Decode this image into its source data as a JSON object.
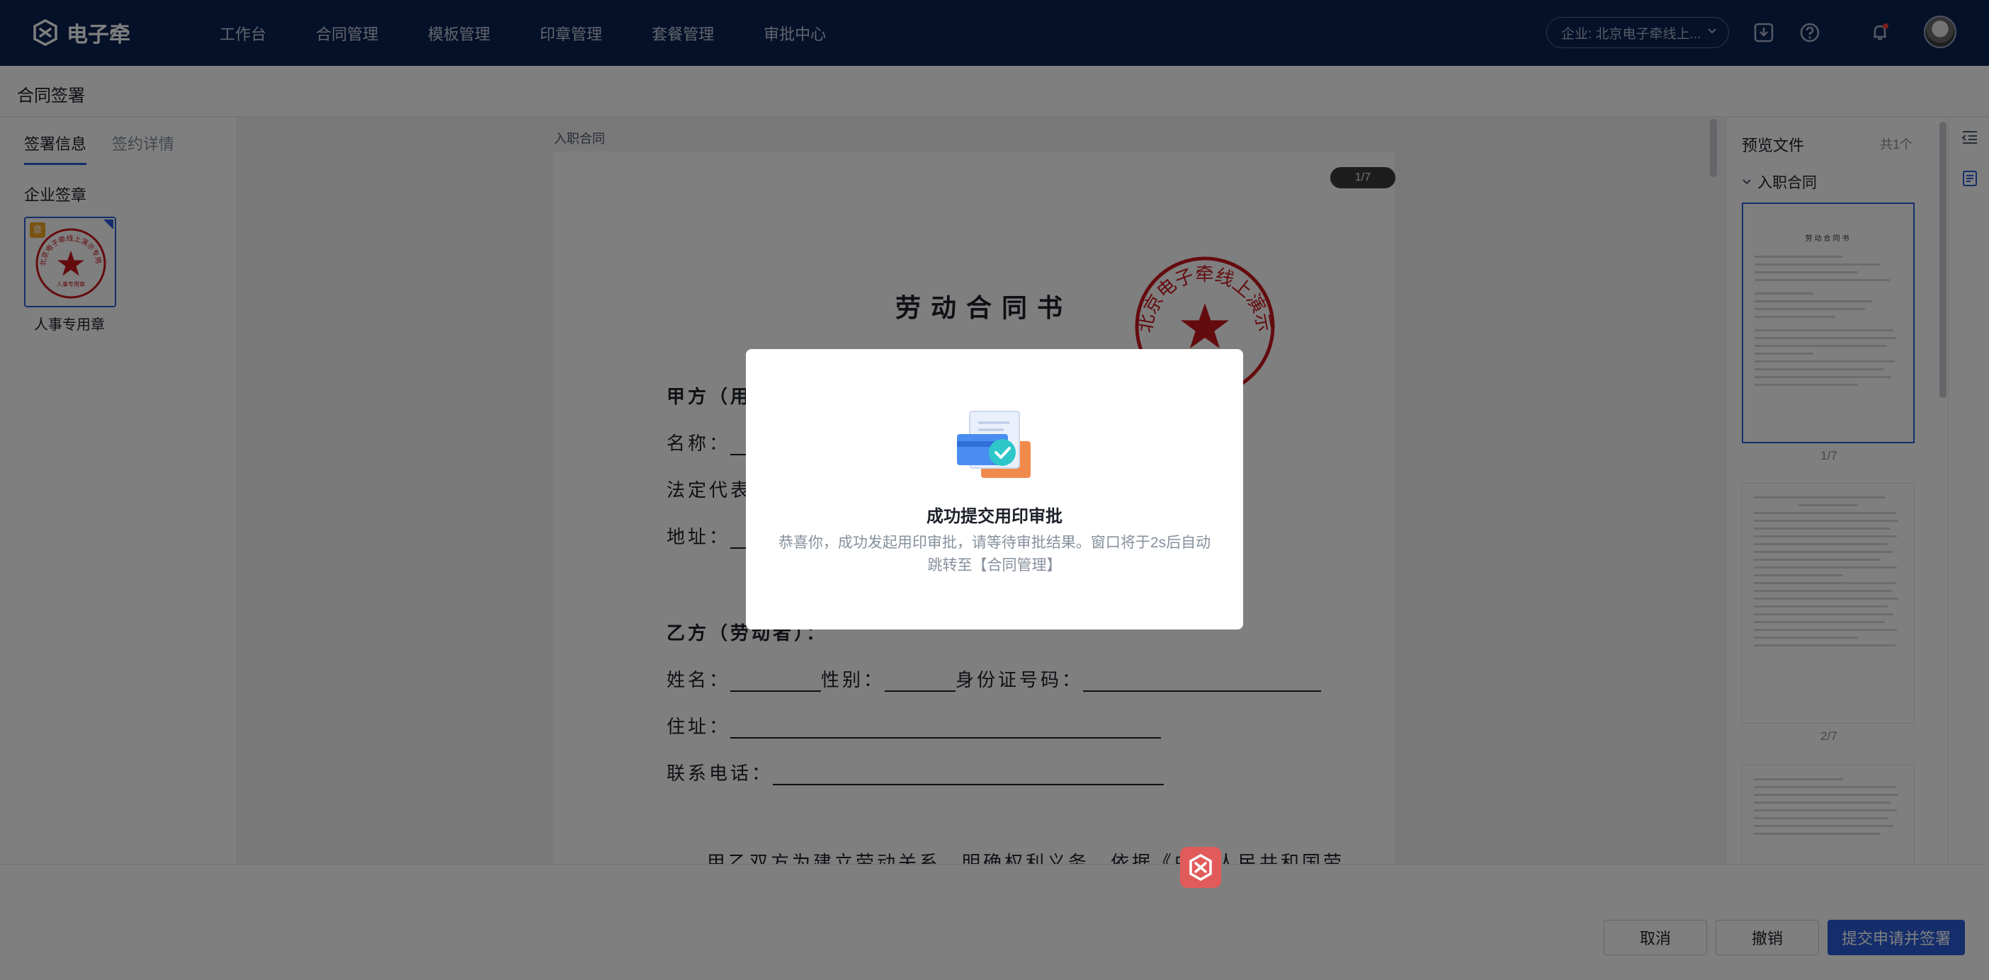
{
  "app": {
    "brand": "电子牵",
    "nav": [
      "工作台",
      "合同管理",
      "模板管理",
      "印章管理",
      "套餐管理",
      "审批中心"
    ],
    "enterprise": "企业: 北京电子牵线上..."
  },
  "page": {
    "title": "合同签署"
  },
  "left_panel": {
    "tabs": [
      "签署信息",
      "签约详情"
    ],
    "section_title": "企业签章",
    "seal": {
      "name": "人事专用章",
      "badge": "章",
      "ring_text": "北京电子牵线上演示专用公司",
      "sub_text": "人事专用章"
    }
  },
  "document": {
    "label": "入职合同",
    "page_indicator": "1/7",
    "title": "劳动合同书",
    "stamp_text": "北京电子牵线上演示专用公司",
    "party_a_heading": "甲方（用",
    "name_label": "名称：",
    "legal_rep_label": "法定代表",
    "address_label": "地址：",
    "party_b_heading": "乙方（劳动者）：",
    "b_name_label": "姓名：",
    "b_gender_label": "性别：",
    "b_id_label": "身份证号码：",
    "b_address_label": "住址：",
    "b_phone_label": "联系电话：",
    "paragraph": "甲乙双方为建立劳动关系，明确权利义务，依据《中华人民共和国劳"
  },
  "preview": {
    "title": "预览文件",
    "count": "共1个",
    "group": "入职合同",
    "thumb_title": "劳动合同书",
    "pages": [
      "1/7",
      "2/7"
    ]
  },
  "footer": {
    "cancel": "取消",
    "revoke": "撤销",
    "submit": "提交申请并签署"
  },
  "modal": {
    "title": "成功提交用印审批",
    "message": "恭喜你，成功发起用印审批，请等待审批结果。窗口将于2s后自动跳转至【合同管理】"
  },
  "colors": {
    "nav_bg": "#0b2350",
    "primary": "#2b5cd7",
    "stamp_red": "#c8161d",
    "overlay": "rgba(0,0,0,0.5)"
  }
}
